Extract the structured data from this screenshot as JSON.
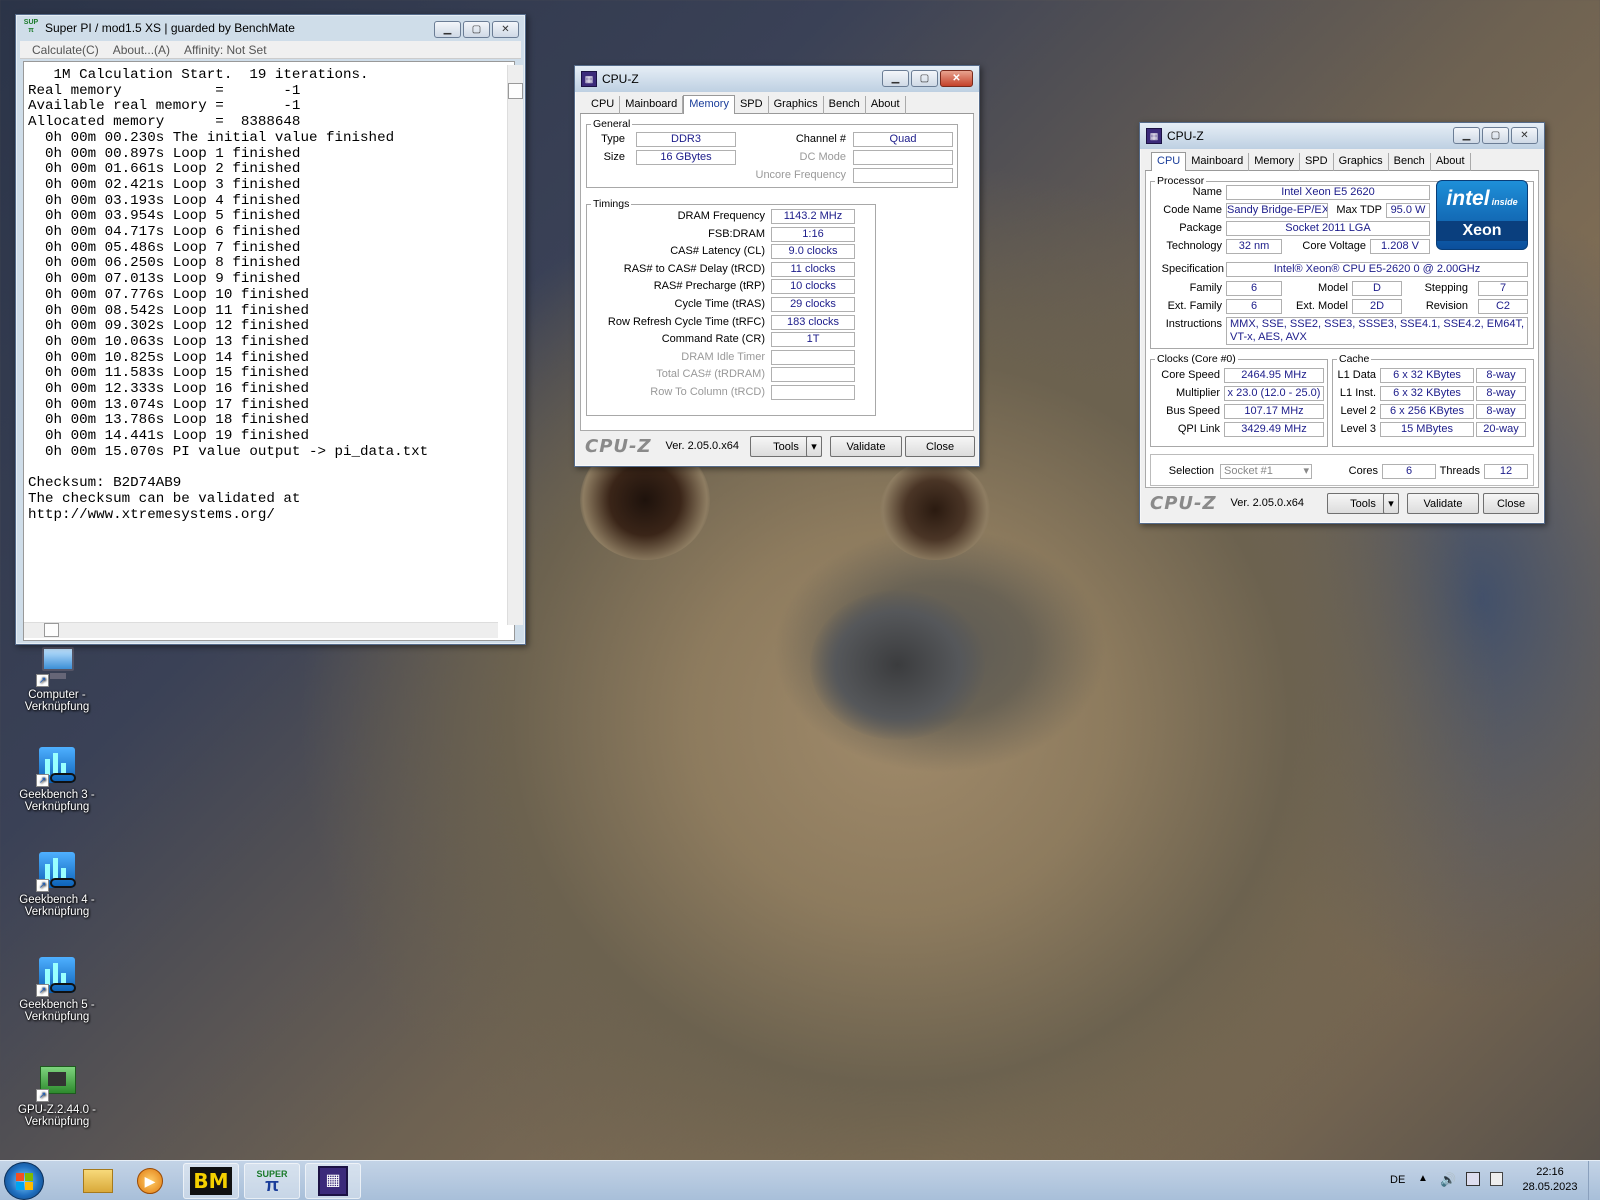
{
  "superpi": {
    "title": "Super PI / mod1.5 XS | guarded by BenchMate",
    "menu": [
      "Calculate(C)",
      "About...(A)",
      "Affinity: Not Set"
    ],
    "console": "   1M Calculation Start.  19 iterations.\nReal memory           =       -1\nAvailable real memory =       -1\nAllocated memory      =  8388648\n  0h 00m 00.230s The initial value finished\n  0h 00m 00.897s Loop 1 finished\n  0h 00m 01.661s Loop 2 finished\n  0h 00m 02.421s Loop 3 finished\n  0h 00m 03.193s Loop 4 finished\n  0h 00m 03.954s Loop 5 finished\n  0h 00m 04.717s Loop 6 finished\n  0h 00m 05.486s Loop 7 finished\n  0h 00m 06.250s Loop 8 finished\n  0h 00m 07.013s Loop 9 finished\n  0h 00m 07.776s Loop 10 finished\n  0h 00m 08.542s Loop 11 finished\n  0h 00m 09.302s Loop 12 finished\n  0h 00m 10.063s Loop 13 finished\n  0h 00m 10.825s Loop 14 finished\n  0h 00m 11.583s Loop 15 finished\n  0h 00m 12.333s Loop 16 finished\n  0h 00m 13.074s Loop 17 finished\n  0h 00m 13.786s Loop 18 finished\n  0h 00m 14.441s Loop 19 finished\n  0h 00m 15.070s PI value output -> pi_data.txt\n\nChecksum: B2D74AB9\nThe checksum can be validated at\nhttp://www.xtremesystems.org/"
  },
  "cpuz_mem": {
    "title": "CPU-Z",
    "tabs": [
      "CPU",
      "Mainboard",
      "Memory",
      "SPD",
      "Graphics",
      "Bench",
      "About"
    ],
    "general_legend": "General",
    "type_label": "Type",
    "type": "DDR3",
    "size_label": "Size",
    "size": "16 GBytes",
    "channel_label": "Channel #",
    "channel": "Quad",
    "dcmode_label": "DC Mode",
    "uncore_label": "Uncore Frequency",
    "timings_legend": "Timings",
    "timings": [
      {
        "label": "DRAM Frequency",
        "value": "1143.2 MHz"
      },
      {
        "label": "FSB:DRAM",
        "value": "1:16"
      },
      {
        "label": "CAS# Latency (CL)",
        "value": "9.0 clocks"
      },
      {
        "label": "RAS# to CAS# Delay (tRCD)",
        "value": "11 clocks"
      },
      {
        "label": "RAS# Precharge (tRP)",
        "value": "10 clocks"
      },
      {
        "label": "Cycle Time (tRAS)",
        "value": "29 clocks"
      },
      {
        "label": "Row Refresh Cycle Time (tRFC)",
        "value": "183 clocks"
      },
      {
        "label": "Command Rate (CR)",
        "value": "1T"
      },
      {
        "label": "DRAM Idle Timer",
        "value": ""
      },
      {
        "label": "Total CAS# (tRDRAM)",
        "value": ""
      },
      {
        "label": "Row To Column (tRCD)",
        "value": ""
      }
    ],
    "logo": "CPU-Z",
    "version": "Ver. 2.05.0.x64",
    "tools": "Tools",
    "validate": "Validate",
    "close": "Close"
  },
  "cpuz_cpu": {
    "title": "CPU-Z",
    "tabs": [
      "CPU",
      "Mainboard",
      "Memory",
      "SPD",
      "Graphics",
      "Bench",
      "About"
    ],
    "processor_legend": "Processor",
    "name_label": "Name",
    "name": "Intel Xeon E5 2620",
    "codename_label": "Code Name",
    "codename": "Sandy Bridge-EP/EX",
    "tdp_label": "Max TDP",
    "tdp": "95.0 W",
    "package_label": "Package",
    "package": "Socket 2011 LGA",
    "tech_label": "Technology",
    "tech": "32 nm",
    "voltage_label": "Core Voltage",
    "voltage": "1.208 V",
    "spec_label": "Specification",
    "spec": "Intel® Xeon® CPU E5-2620 0 @ 2.00GHz",
    "family_label": "Family",
    "family": "6",
    "model_label": "Model",
    "model": "D",
    "stepping_label": "Stepping",
    "stepping": "7",
    "extfamily_label": "Ext. Family",
    "extfamily": "6",
    "extmodel_label": "Ext. Model",
    "extmodel": "2D",
    "revision_label": "Revision",
    "revision": "C2",
    "instr_label": "Instructions",
    "instr": "MMX, SSE, SSE2, SSE3, SSSE3, SSE4.1, SSE4.2, EM64T, VT-x, AES, AVX",
    "intel_logo_top": "intel",
    "intel_logo_inside": "inside",
    "intel_logo_bottom": "Xeon",
    "clocks_legend": "Clocks (Core #0)",
    "corespeed_label": "Core Speed",
    "corespeed": "2464.95 MHz",
    "multiplier_label": "Multiplier",
    "multiplier": "x 23.0 (12.0 - 25.0)",
    "busspeed_label": "Bus Speed",
    "busspeed": "107.17 MHz",
    "qpi_label": "QPI Link",
    "qpi": "3429.49 MHz",
    "cache_legend": "Cache",
    "l1d_label": "L1 Data",
    "l1d": "6 x 32 KBytes",
    "l1d_way": "8-way",
    "l1i_label": "L1 Inst.",
    "l1i": "6 x 32 KBytes",
    "l1i_way": "8-way",
    "l2_label": "Level 2",
    "l2": "6 x 256 KBytes",
    "l2_way": "8-way",
    "l3_label": "Level 3",
    "l3": "15 MBytes",
    "l3_way": "20-way",
    "selection_label": "Selection",
    "selection": "Socket #1",
    "cores_label": "Cores",
    "cores": "6",
    "threads_label": "Threads",
    "threads": "12",
    "logo": "CPU-Z",
    "version": "Ver. 2.05.0.x64",
    "tools": "Tools",
    "validate": "Validate",
    "close": "Close"
  },
  "desktop": [
    {
      "label": "Computer -\nVerknüpfung",
      "icon": "computer-icon"
    },
    {
      "label": "Geekbench 3 -\nVerknüpfung",
      "icon": "geekbench-icon"
    },
    {
      "label": "Geekbench 4 -\nVerknüpfung",
      "icon": "geekbench-icon"
    },
    {
      "label": "Geekbench 5 -\nVerknüpfung",
      "icon": "geekbench-icon"
    },
    {
      "label": "GPU-Z.2.44.0 -\nVerknüpfung",
      "icon": "gpuz-icon"
    }
  ],
  "taskbar": {
    "lang": "DE",
    "time": "22:16",
    "date": "28.05.2023",
    "bm_label": "BM",
    "spi_label": "SUPER"
  }
}
